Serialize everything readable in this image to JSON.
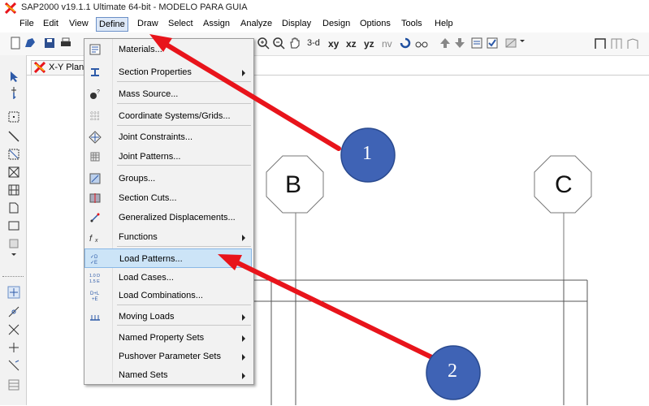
{
  "titlebar": {
    "title": "SAP2000 v19.1.1 Ultimate 64-bit - MODELO PARA GUIA"
  },
  "menubar": {
    "items": [
      "File",
      "Edit",
      "View",
      "Define",
      "Draw",
      "Select",
      "Assign",
      "Analyze",
      "Display",
      "Design",
      "Options",
      "Tools",
      "Help"
    ]
  },
  "toolbar": {
    "view_buttons": [
      "3-d",
      "xy",
      "xz",
      "yz",
      "nv"
    ]
  },
  "tab": {
    "label": "X-Y Plane @"
  },
  "define_menu": {
    "items": [
      {
        "label": "Materials...",
        "icon": "materials-icon",
        "submenu": false
      },
      {
        "label": "Section Properties",
        "icon": "section-properties-icon",
        "submenu": true
      },
      {
        "label": "Mass Source...",
        "icon": "mass-source-icon",
        "submenu": false
      },
      {
        "label": "Coordinate Systems/Grids...",
        "icon": "grid-icon",
        "submenu": false
      },
      {
        "label": "Joint Constraints...",
        "icon": "joint-constraints-icon",
        "submenu": false
      },
      {
        "label": "Joint Patterns...",
        "icon": "joint-patterns-icon",
        "submenu": false
      },
      {
        "label": "Groups...",
        "icon": "groups-icon",
        "submenu": false
      },
      {
        "label": "Section Cuts...",
        "icon": "section-cuts-icon",
        "submenu": false
      },
      {
        "label": "Generalized Displacements...",
        "icon": "generalized-displacements-icon",
        "submenu": false
      },
      {
        "label": "Functions",
        "icon": "functions-icon",
        "submenu": true
      },
      {
        "label": "Load Patterns...",
        "icon": "load-patterns-icon",
        "submenu": false,
        "highlighted": true
      },
      {
        "label": "Load Cases...",
        "icon": "load-cases-icon",
        "submenu": false
      },
      {
        "label": "Load Combinations...",
        "icon": "load-combinations-icon",
        "submenu": false
      },
      {
        "label": "Moving Loads",
        "icon": "moving-loads-icon",
        "submenu": true
      },
      {
        "label": "Named Property Sets",
        "icon": "",
        "submenu": true
      },
      {
        "label": "Pushover Parameter Sets",
        "icon": "",
        "submenu": true
      },
      {
        "label": "Named Sets",
        "icon": "",
        "submenu": true
      }
    ]
  },
  "grid_bubbles": {
    "b": "B",
    "c": "C"
  },
  "annotations": {
    "step1": "1",
    "step2": "2",
    "arrow_color": "#e8141b",
    "circle_color": "#3f63b5"
  },
  "colors": {
    "menu_highlight": "#cce4f7",
    "app_icon": "#e8a20f"
  }
}
